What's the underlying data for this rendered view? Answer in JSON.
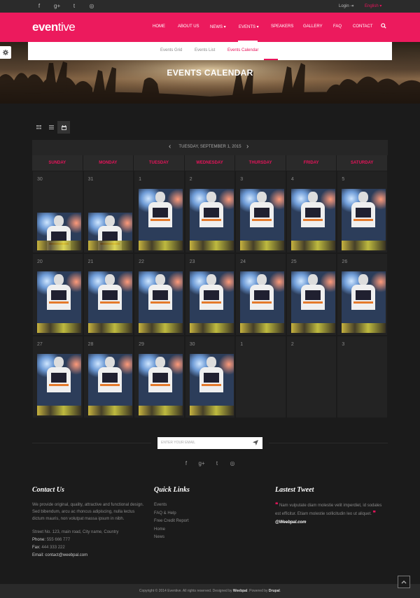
{
  "topbar": {
    "social_icons": [
      "facebook-icon",
      "google-plus-icon",
      "twitter-icon",
      "instagram-icon"
    ],
    "social_glyphs": [
      "f",
      "g+",
      "t",
      "◎"
    ],
    "login": "Login ⇥",
    "language": "English ▾"
  },
  "header": {
    "logo_bold": "even",
    "logo_light": "tive",
    "accent_color": "#ec1a5d",
    "nav": [
      "HOME",
      "ABOUT US",
      "NEWS ▾",
      "EVENTS ▾",
      "SPEAKERS",
      "GALLERY",
      "FAQ",
      "CONTACT"
    ],
    "active_nav": "EVENTS"
  },
  "subnav": {
    "items": [
      "Events Grid",
      "Events List",
      "Events Calendar"
    ],
    "active": "Events Calendar"
  },
  "hero": {
    "title": "EVENTS CALENDAR"
  },
  "calendar": {
    "title": "TUESDAY, SEPTEMBER 1, 2015",
    "prev": "‹",
    "next": "›",
    "days_of_week": [
      "SUNDAY",
      "MONDAY",
      "TUESDAY",
      "WEDNESDAY",
      "THURSDAY",
      "FRIDAY",
      "SATURDAY"
    ],
    "weeks": [
      [
        "30",
        "31",
        "1",
        "2",
        "3",
        "4",
        "5"
      ],
      [
        "20",
        "21",
        "22",
        "23",
        "24",
        "25",
        "26"
      ],
      [
        "27",
        "28",
        "29",
        "30",
        "1",
        "2",
        "3"
      ]
    ]
  },
  "subscribe": {
    "placeholder": "ENTER YOUR EMAIL"
  },
  "footer_social": [
    "f",
    "g+",
    "t",
    "◎"
  ],
  "footer": {
    "contact": {
      "heading": "Contact Us",
      "text": "We provide original, quality, attractive and functional design. Sed bibendum, arcu ac rhoncus adipiscing, nulla lectus dictum mauris, non volutpat massa ipsum in nibh.",
      "street": "Street No. 123, main road, City name, Country",
      "phone_label": "Phone:",
      "phone": "555 666 777",
      "fax_label": "Fax:",
      "fax": "444 333 222",
      "email_label": "Email:",
      "email": "contact@weebpal.com"
    },
    "quick_links": {
      "heading": "Quick Links",
      "items": [
        "Events",
        "FAQ & Help",
        "Free Credit Report",
        "Home",
        "News"
      ]
    },
    "tweet": {
      "heading": "Lastest Tweet",
      "open_quote": "❝",
      "close_quote": "❞",
      "text": "Nam vulputate diam molestie velit imperdiet, id sodales est efficitur. Etiam molestie sollicitudin leo ut aliquet.",
      "handle": "@Weebpal.com"
    }
  },
  "bottom": {
    "copy_prefix": "Copyright © 2014 Eventive. All rights reserved. Designed by",
    "designer": "Weebpal",
    "powered": ". Powered by",
    "platform": "Drupal",
    "end": "."
  }
}
